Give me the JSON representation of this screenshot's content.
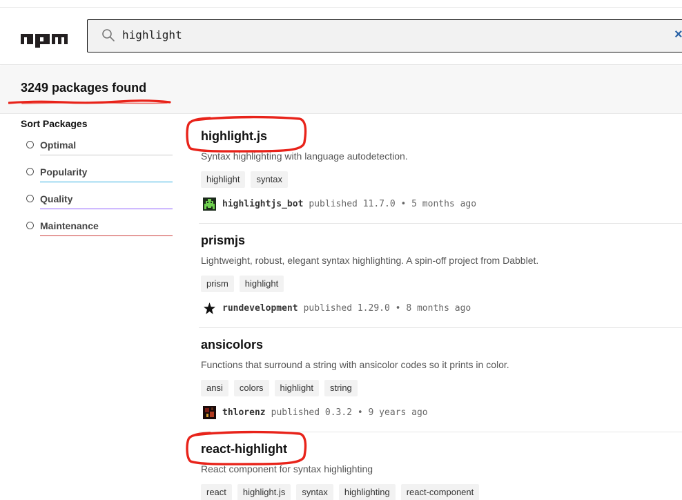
{
  "search": {
    "value": "highlight",
    "clear_icon": "×"
  },
  "summary": {
    "count_text": "3249 packages found"
  },
  "sort": {
    "title": "Sort Packages",
    "options": [
      {
        "label": "Optimal",
        "color": "#c9c9c9"
      },
      {
        "label": "Popularity",
        "color": "#29abe0"
      },
      {
        "label": "Quality",
        "color": "#8956ff"
      },
      {
        "label": "Maintenance",
        "color": "#cb3837"
      }
    ]
  },
  "packages": [
    {
      "name": "highlight.js",
      "description": "Syntax highlighting with language autodetection.",
      "keywords": [
        "highlight",
        "syntax"
      ],
      "publisher": "highlightjs_bot",
      "published_label": "published",
      "version": "11.7.0",
      "separator": "•",
      "age": "5 months ago"
    },
    {
      "name": "prismjs",
      "description": "Lightweight, robust, elegant syntax highlighting. A spin-off project from Dabblet.",
      "keywords": [
        "prism",
        "highlight"
      ],
      "publisher": "rundevelopment",
      "published_label": "published",
      "version": "1.29.0",
      "separator": "•",
      "age": "8 months ago"
    },
    {
      "name": "ansicolors",
      "description": "Functions that surround a string with ansicolor codes so it prints in color.",
      "keywords": [
        "ansi",
        "colors",
        "highlight",
        "string"
      ],
      "publisher": "thlorenz",
      "published_label": "published",
      "version": "0.3.2",
      "separator": "•",
      "age": "9 years ago"
    },
    {
      "name": "react-highlight",
      "description": "React component for syntax highlighting",
      "keywords": [
        "react",
        "highlight.js",
        "syntax",
        "highlighting",
        "react-component"
      ]
    }
  ],
  "colors": {
    "annotation_red": "#e8231a",
    "npm_red": "#cb3837"
  }
}
